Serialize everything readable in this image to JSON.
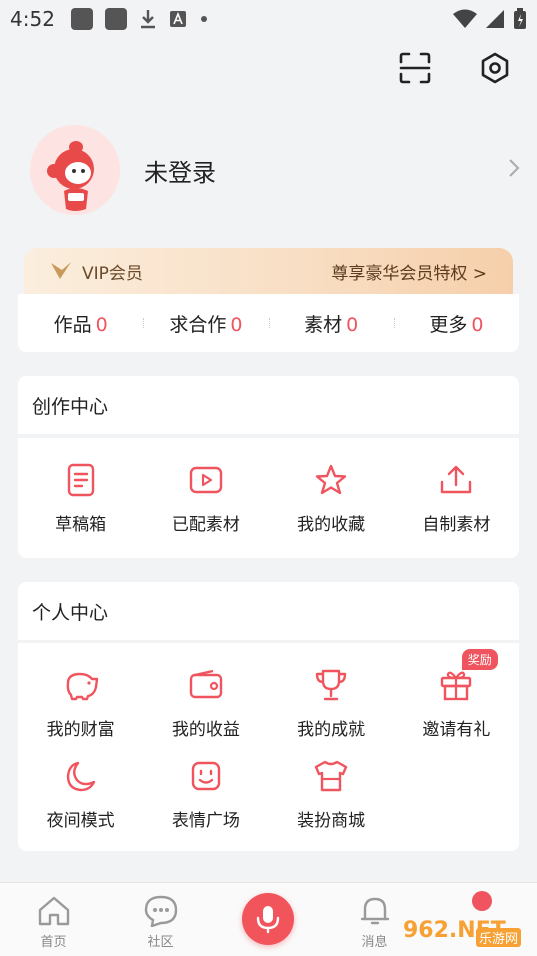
{
  "status": {
    "time": "4:52"
  },
  "profile": {
    "login_text": "未登录"
  },
  "vip": {
    "label": "VIP会员",
    "privilege": "尊享豪华会员特权 >"
  },
  "stats": [
    {
      "label": "作品",
      "count": "0"
    },
    {
      "label": "求合作",
      "count": "0"
    },
    {
      "label": "素材",
      "count": "0"
    },
    {
      "label": "更多",
      "count": "0"
    }
  ],
  "creation_center": {
    "title": "创作中心",
    "items": [
      {
        "label": "草稿箱",
        "icon": "draft-icon"
      },
      {
        "label": "已配素材",
        "icon": "play-box-icon"
      },
      {
        "label": "我的收藏",
        "icon": "star-icon"
      },
      {
        "label": "自制素材",
        "icon": "upload-icon"
      }
    ]
  },
  "personal_center": {
    "title": "个人中心",
    "items": [
      {
        "label": "我的财富",
        "icon": "piggy-bank-icon"
      },
      {
        "label": "我的收益",
        "icon": "wallet-icon"
      },
      {
        "label": "我的成就",
        "icon": "trophy-icon"
      },
      {
        "label": "邀请有礼",
        "icon": "gift-icon",
        "badge": "奖励"
      },
      {
        "label": "夜间模式",
        "icon": "moon-icon"
      },
      {
        "label": "表情广场",
        "icon": "emoji-icon"
      },
      {
        "label": "装扮商城",
        "icon": "shirt-icon"
      }
    ]
  },
  "bottom_nav": [
    {
      "label": "首页",
      "icon": "home-icon"
    },
    {
      "label": "社区",
      "icon": "chat-icon"
    },
    {
      "label": "",
      "icon": "mic-icon"
    },
    {
      "label": "消息",
      "icon": "bell-icon"
    },
    {
      "label": "",
      "icon": "profile-icon"
    }
  ],
  "watermark": {
    "main": "962.NET",
    "sub": "乐游网"
  },
  "colors": {
    "accent": "#f0555f",
    "background": "#f2f3f5",
    "vip_text": "#6b4a2b"
  }
}
